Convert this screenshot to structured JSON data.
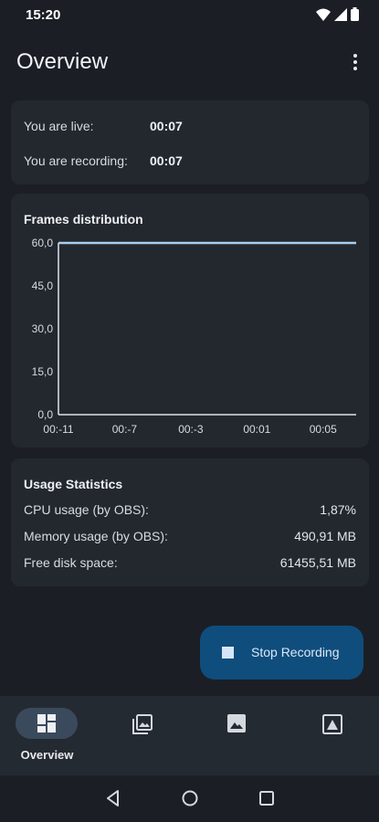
{
  "status_bar": {
    "time": "15:20",
    "icons": [
      "wifi-icon",
      "signal-icon",
      "battery-icon"
    ]
  },
  "app_bar": {
    "title": "Overview",
    "menu_icon": "more-vert-icon"
  },
  "live_card": {
    "live_label": "You are live:",
    "live_value": "00:07",
    "recording_label": "You are recording:",
    "recording_value": "00:07"
  },
  "chart_card": {
    "title": "Frames distribution"
  },
  "chart_data": {
    "type": "line",
    "title": "Frames distribution",
    "x_tick_labels": [
      "00:-11",
      "00:-7",
      "00:-3",
      "00:01",
      "00:05"
    ],
    "y_tick_labels": [
      "60,0",
      "45,0",
      "30,0",
      "15,0",
      "0,0"
    ],
    "ylim": [
      0,
      60
    ],
    "xlim": [
      -11,
      7
    ],
    "series": [
      {
        "x": [
          -11,
          7
        ],
        "values": [
          60,
          60
        ]
      }
    ],
    "colors": {
      "line": "#a9cfee",
      "axis": "#e0e2e6"
    },
    "grid": false
  },
  "stats_card": {
    "title": "Usage Statistics",
    "rows": [
      {
        "label": "CPU usage (by OBS):",
        "value": "1,87%"
      },
      {
        "label": "Memory usage (by OBS):",
        "value": "490,91 MB"
      },
      {
        "label": "Free disk space:",
        "value": "61455,51 MB"
      }
    ]
  },
  "fab": {
    "label": "Stop Recording",
    "icon": "stop-icon"
  },
  "bottom_nav": {
    "items": [
      {
        "label": "Overview",
        "icon": "dashboard-icon",
        "active": true
      },
      {
        "label": "",
        "icon": "photo-library-icon"
      },
      {
        "label": "",
        "icon": "image-icon"
      },
      {
        "label": "",
        "icon": "wallpaper-icon"
      }
    ]
  },
  "system_nav": {
    "icons": [
      "back-icon",
      "home-icon",
      "recents-icon"
    ]
  },
  "colors": {
    "background": "#1b1f25",
    "card": "#23282f",
    "fab": "#0f4d7d",
    "nav_active": "#3a4a5c"
  }
}
